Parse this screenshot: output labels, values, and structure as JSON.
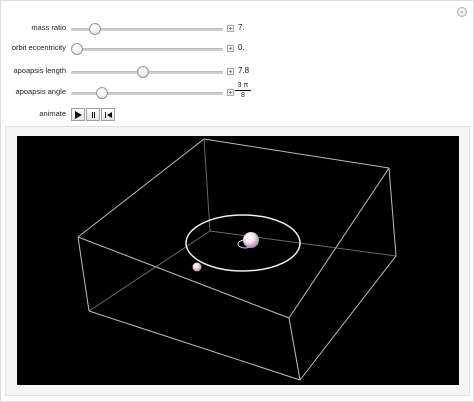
{
  "controls": {
    "mass_ratio": {
      "label": "mass ratio",
      "value": "7.",
      "fraction": 0.16
    },
    "orbit_eccentricity": {
      "label": "orbit eccentricity",
      "value": "0.",
      "fraction": 0.04
    },
    "apoapsis_length": {
      "label": "apoapsis length",
      "value": "7.8",
      "fraction": 0.47
    },
    "apoapsis_angle": {
      "label": "apoapsis angle",
      "value_numerator": "3 π",
      "value_denominator": "8",
      "fraction": 0.2
    }
  },
  "animate": {
    "label": "animate"
  },
  "icons": {
    "reset": "reset-circle-icon",
    "play": "play-icon",
    "pause": "pause-icon",
    "step_back": "step-back-icon",
    "plus": "plus-icon"
  },
  "colors": {
    "background": "#ffffff",
    "viewport_bg": "#000000",
    "box_lines": "#bfbfbf",
    "orbit_line": "#e8e8e8",
    "panel_bg": "#f5f5f5"
  }
}
